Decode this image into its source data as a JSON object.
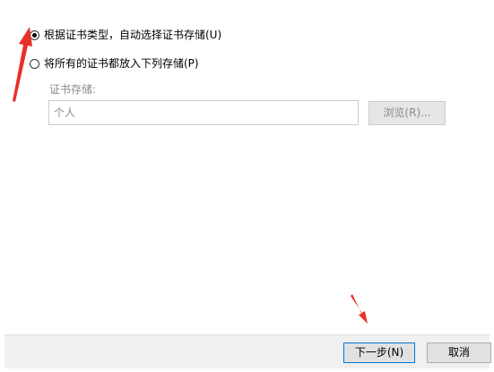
{
  "options": {
    "auto_select": {
      "label": "根据证书类型，自动选择证书存储(U)",
      "checked": true
    },
    "manual_store": {
      "label": "将所有的证书都放入下列存储(P)",
      "checked": false
    }
  },
  "certificate_store": {
    "label": "证书存储:",
    "value": "个人",
    "browse_label": "浏览(R)..."
  },
  "footer": {
    "next_label": "下一步(N)",
    "cancel_label": "取消"
  },
  "colors": {
    "annotation_arrow": "#e8302a",
    "footer_background": "#f0f0f0",
    "disabled_text": "#8a8a8a"
  }
}
